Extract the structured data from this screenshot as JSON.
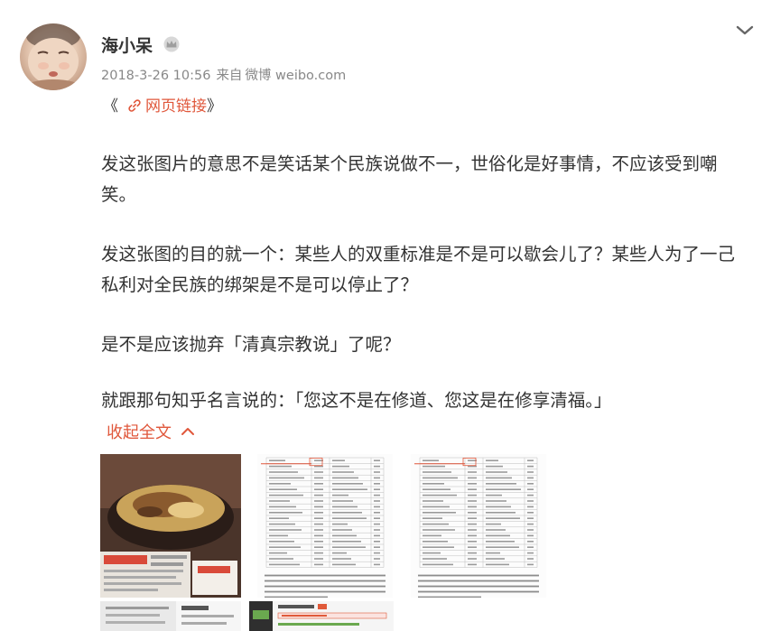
{
  "post": {
    "author": {
      "name": "海小呆",
      "avatar_icon": "baby-avatar",
      "badge_icon": "crown-icon"
    },
    "meta": {
      "timestamp": "2018-3-26 10:56",
      "source_prefix": "来自",
      "source": "微博 weibo.com"
    },
    "link": {
      "open": "《",
      "label": "网页链接",
      "close": "》",
      "icon": "link-icon"
    },
    "paragraphs": [
      "发这张图片的意思不是笑话某个民族说做不一，世俗化是好事情，不应该受到嘲笑。",
      "发这张图的目的就一个：某些人的双重标准是不是可以歇会儿了？某些人为了一己私利对全民族的绑架是不是可以停止了？",
      "是不是应该抛弃「清真宗教说」了呢？",
      "就跟那句知乎名言说的：「您这不是在修道、您这是在修享清福。」"
    ],
    "collapse_label": "收起全文",
    "images": [
      {
        "name": "food-photo"
      },
      {
        "name": "document-table-1"
      },
      {
        "name": "document-table-2"
      },
      {
        "name": "receipt-photo"
      },
      {
        "name": "chat-screenshot"
      }
    ]
  },
  "colors": {
    "accent": "#e0573b",
    "text": "#333333",
    "meta": "#888888"
  }
}
